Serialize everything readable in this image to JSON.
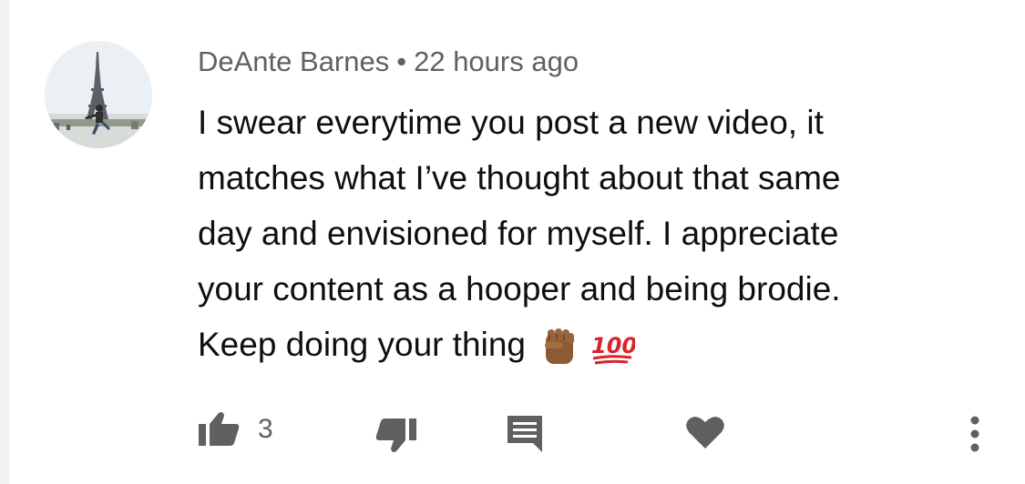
{
  "comment": {
    "author": "DeAnte Barnes",
    "separator": "•",
    "time": "22 hours ago",
    "text": "I swear everytime you post a new video, it\nmatches what I’ve thought about that same\nday and envisioned for myself. I appreciate\nyour content as a hooper and being brodie.\nKeep doing your thing",
    "emojis": [
      "raised-fist-medium-dark-emoji",
      "hundred-points-emoji"
    ]
  },
  "actions": {
    "like_count": "3",
    "icons": [
      "thumbs-up-icon",
      "thumbs-down-icon",
      "reply-icon",
      "heart-icon",
      "more-vert-icon"
    ]
  },
  "colors": {
    "text": "#0f0f0f",
    "meta": "#606060",
    "icon": "#606060",
    "background": "#ffffff"
  }
}
